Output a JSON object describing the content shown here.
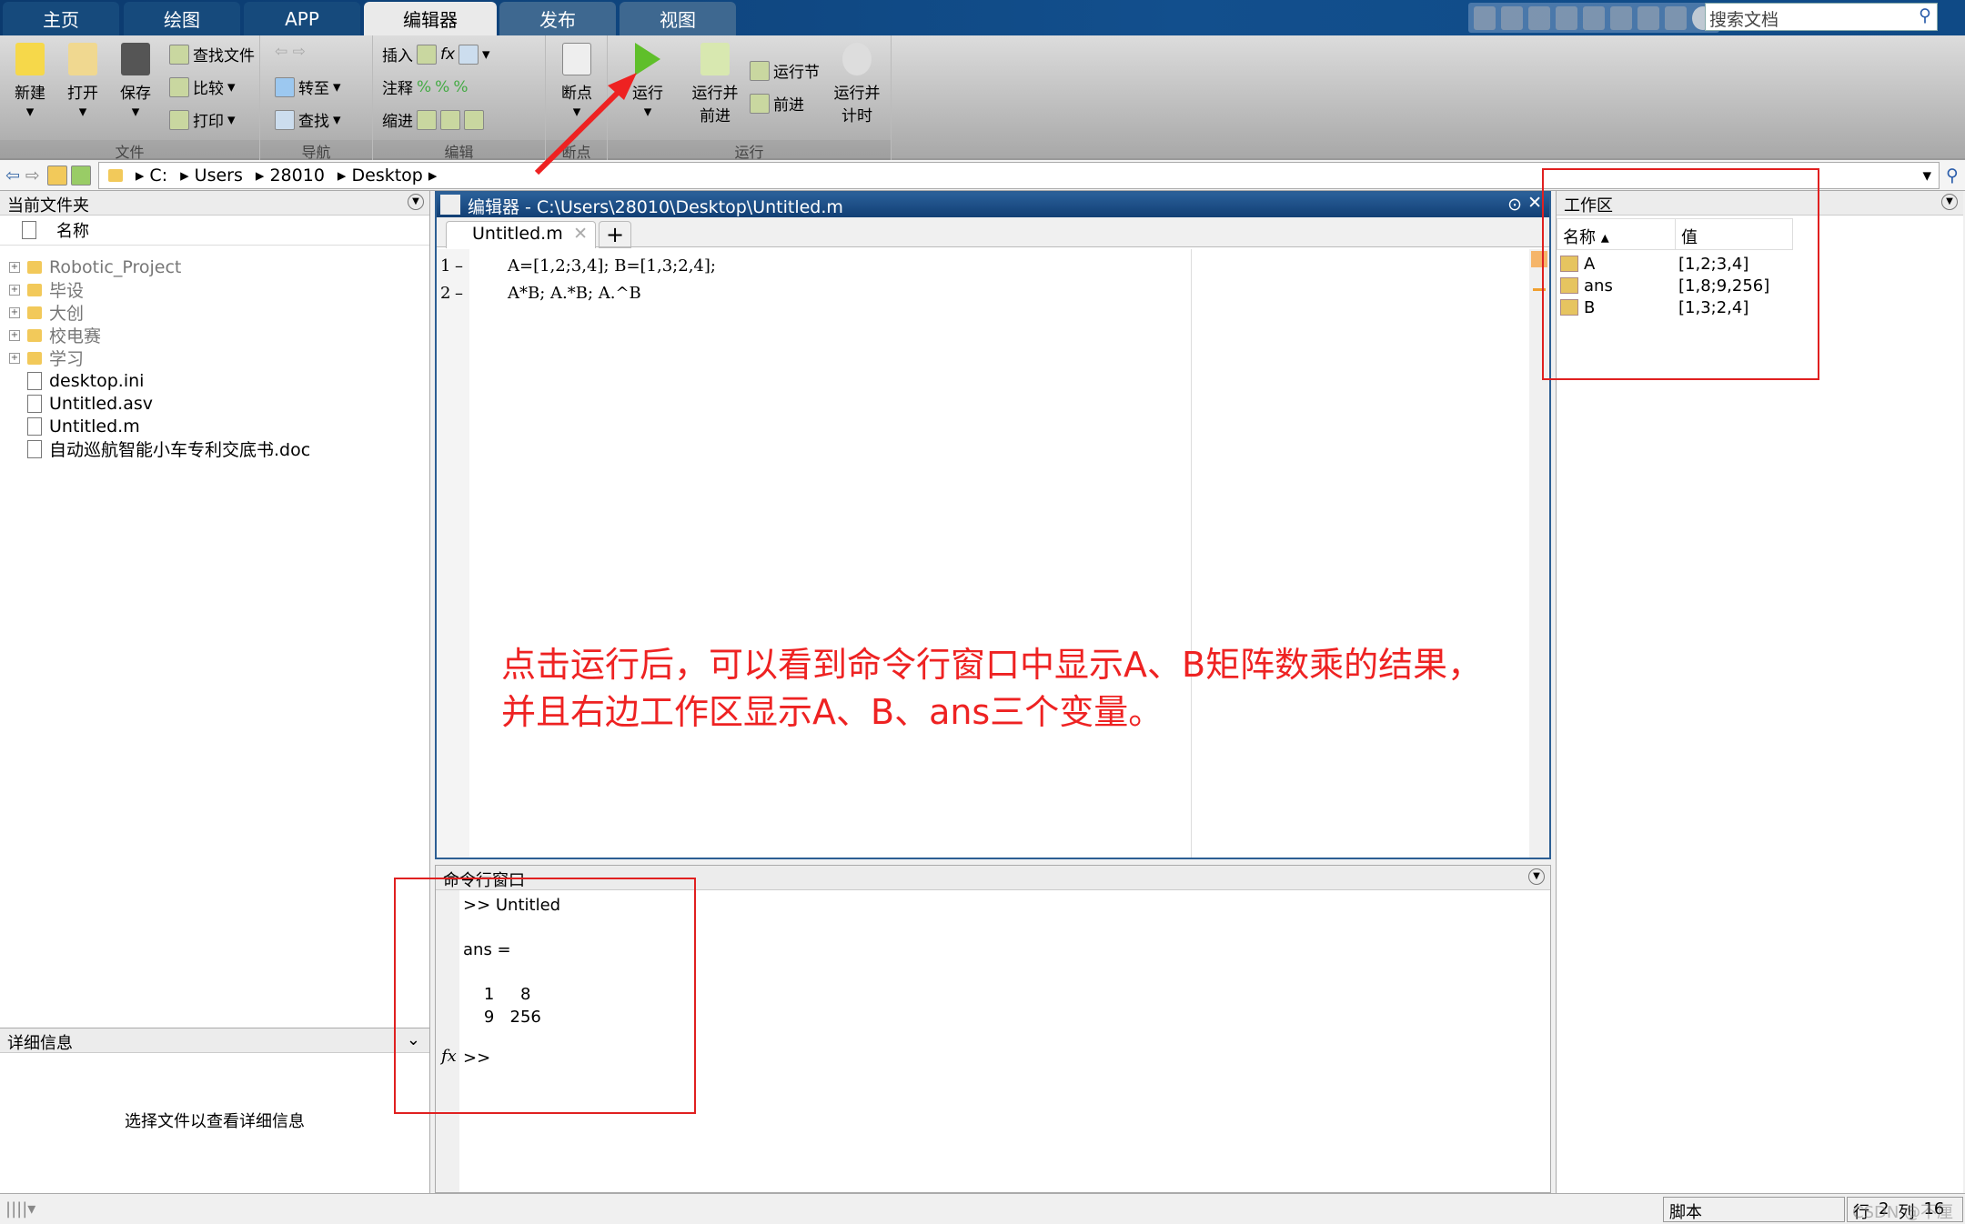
{
  "ribbon_tabs": [
    "主页",
    "绘图",
    "APP",
    "编辑器",
    "发布",
    "视图"
  ],
  "active_tab": "编辑器",
  "search_placeholder": "搜索文档",
  "toolstrip": {
    "file": {
      "label": "文件",
      "new": "新建",
      "open": "打开",
      "save": "保存",
      "find_files": "查找文件",
      "compare": "比较",
      "print": "打印"
    },
    "nav": {
      "label": "导航",
      "goto": "转至",
      "find": "查找"
    },
    "edit": {
      "label": "编辑",
      "insert": "插入",
      "comment": "注释",
      "indent": "缩进",
      "fx": "fx"
    },
    "breakpoints": {
      "label": "断点",
      "btn": "断点"
    },
    "run": {
      "label": "运行",
      "run": "运行",
      "run_advance_1": "运行并",
      "run_advance_2": "前进",
      "run_section": "运行节",
      "advance": "前进",
      "run_time_1": "运行并",
      "run_time_2": "计时"
    }
  },
  "address": [
    "C:",
    "Users",
    "28010",
    "Desktop"
  ],
  "current_folder": {
    "title": "当前文件夹",
    "col_name": "名称",
    "items": [
      {
        "name": "Robotic_Project",
        "type": "folder"
      },
      {
        "name": "毕设",
        "type": "folder"
      },
      {
        "name": "大创",
        "type": "folder"
      },
      {
        "name": "校电赛",
        "type": "folder"
      },
      {
        "name": "学习",
        "type": "folder"
      },
      {
        "name": "desktop.ini",
        "type": "file"
      },
      {
        "name": "Untitled.asv",
        "type": "file"
      },
      {
        "name": "Untitled.m",
        "type": "file"
      },
      {
        "name": "自动巡航智能小车专利交底书.doc",
        "type": "file"
      }
    ]
  },
  "details": {
    "title": "详细信息",
    "hint": "选择文件以查看详细信息"
  },
  "editor": {
    "title": "编辑器 - C:\\Users\\28010\\Desktop\\Untitled.m",
    "tab": "Untitled.m",
    "lines": [
      {
        "n": "1",
        "code": "A=[1,2;3,4]; B=[1,3;2,4];"
      },
      {
        "n": "2",
        "code": "A*B; A.*B; A.^B"
      }
    ]
  },
  "command": {
    "title": "命令行窗口",
    "lines": [
      ">> Untitled",
      "",
      "ans =",
      "",
      "    1     8",
      "    9   256",
      "",
      ""
    ],
    "prompt": ">>",
    "fx": "fx"
  },
  "workspace": {
    "title": "工作区",
    "col_name": "名称",
    "col_value": "值",
    "vars": [
      {
        "name": "A",
        "value": "[1,2;3,4]"
      },
      {
        "name": "ans",
        "value": "[1,8;9,256]"
      },
      {
        "name": "B",
        "value": "[1,3;2,4]"
      }
    ]
  },
  "status": {
    "mode": "脚本",
    "row_label": "行",
    "row": "2",
    "col_label": "列",
    "col": "16"
  },
  "annotation": {
    "line1": "点击运行后，可以看到命令行窗口中显示A、B矩阵数乘的结果，",
    "line2": "并且右边工作区显示A、B、ans三个变量。",
    "color": "#ee2222"
  },
  "watermark": "CSDN @不厘"
}
